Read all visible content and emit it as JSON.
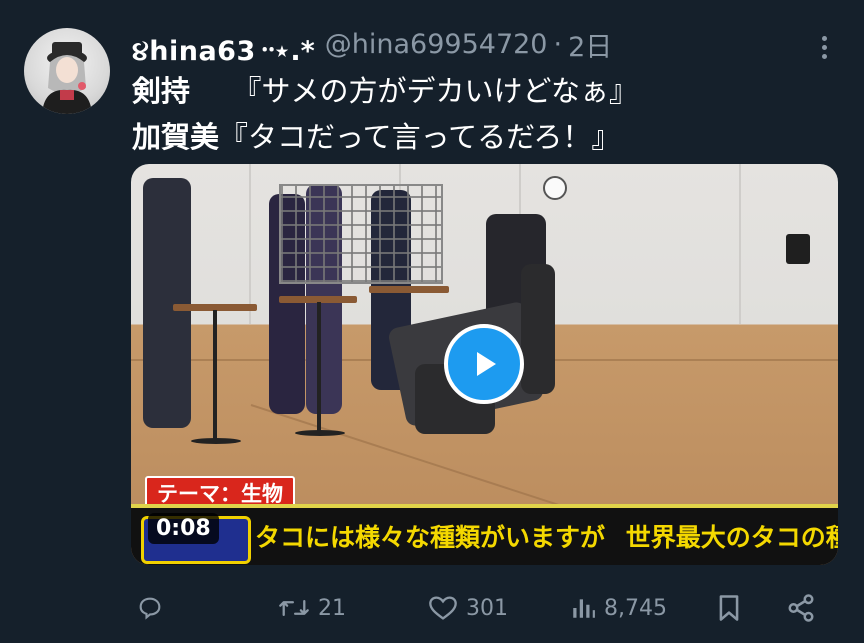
{
  "tweet": {
    "author": {
      "display_name": "૪hina63᠃⋆.*",
      "handle": "@hina69954720",
      "separator": "·",
      "time": "2日"
    },
    "lines": [
      {
        "speaker": "剣持",
        "gap": "　",
        "quote": "『サメの方がデカいけどなぁ』"
      },
      {
        "speaker": "加賀美",
        "gap": "",
        "quote": "『タコだって言ってるだろ！』"
      }
    ],
    "media": {
      "duration": "0:08",
      "theme_tag": "テーマ：生物",
      "subtitle_part1": "タコには様々な種類がいますが",
      "subtitle_part2": "世界最大のタコの種は?",
      "play_icon": "play-icon"
    },
    "actions": {
      "reply_count": "",
      "retweet_count": "21",
      "like_count": "301",
      "view_count": "8,745"
    }
  },
  "colors": {
    "background": "#15202b",
    "muted_text": "#8b98a5",
    "accent": "#1d9bf0"
  }
}
